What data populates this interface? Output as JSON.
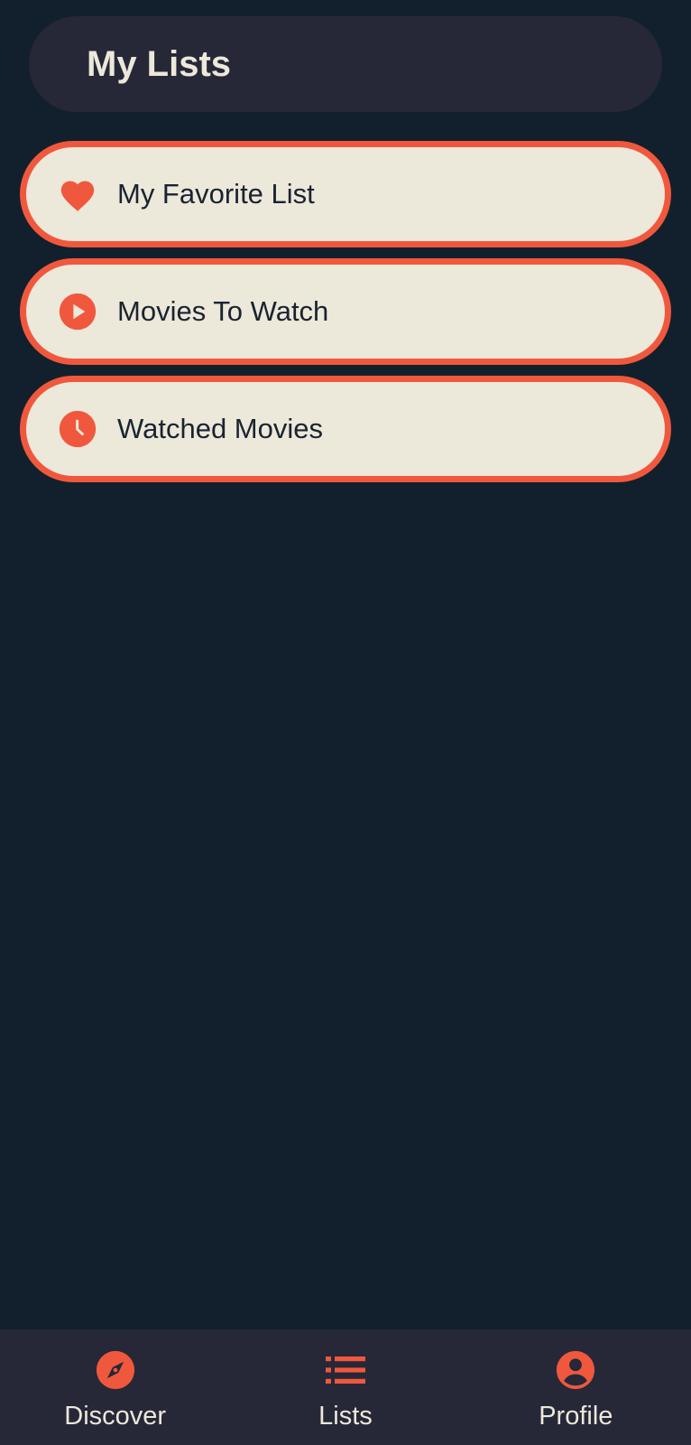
{
  "header": {
    "title": "My Lists"
  },
  "lists": [
    {
      "label": "My Favorite List",
      "icon": "heart-icon"
    },
    {
      "label": "Movies To Watch",
      "icon": "play-circle-icon"
    },
    {
      "label": "Watched Movies",
      "icon": "clock-icon"
    }
  ],
  "bottom_nav": {
    "items": [
      {
        "label": "Discover",
        "icon": "compass-icon"
      },
      {
        "label": "Lists",
        "icon": "list-icon",
        "active": true
      },
      {
        "label": "Profile",
        "icon": "account-circle-icon"
      }
    ]
  },
  "colors": {
    "background": "#12202d",
    "surface": "#262838",
    "accent": "#f0583d",
    "card": "#ece8da",
    "text_dark": "#1a2330",
    "text_light": "#ece8da"
  }
}
